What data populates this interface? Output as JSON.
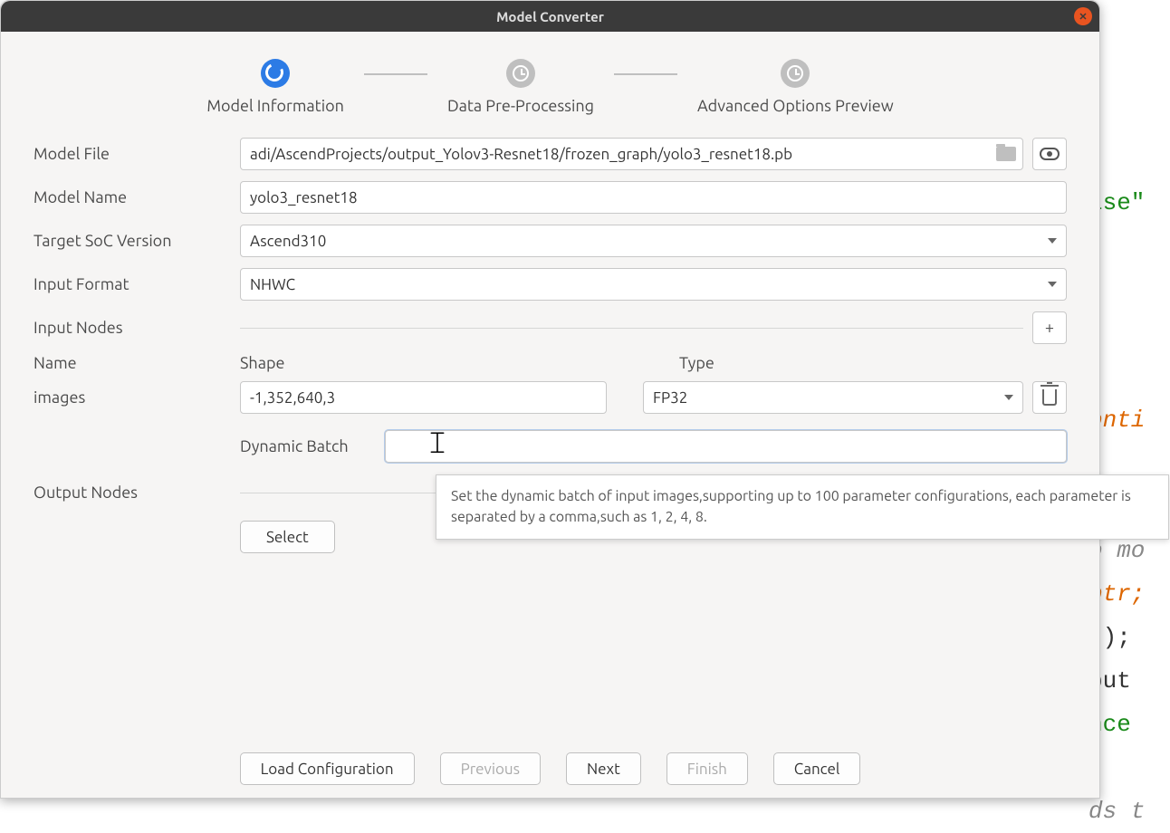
{
  "bgCode": {
    "l1": "lse\"",
    "l2": ";",
    "l3": "onti",
    "l4": "o mo",
    "l5": "ptr;",
    "l6": "t);",
    "l7": "put",
    "l8": "nce",
    "l9": "ds t"
  },
  "title": "Model Converter",
  "stepper": {
    "s1": "Model Information",
    "s2": "Data Pre-Processing",
    "s3": "Advanced Options  Preview"
  },
  "labels": {
    "modelFile": "Model File",
    "modelName": "Model Name",
    "targetSoc": "Target SoC Version",
    "inputFormat": "Input Format",
    "inputNodes": "Input Nodes",
    "name": "Name",
    "shape": "Shape",
    "type": "Type",
    "images": "images",
    "dynamicBatch": "Dynamic Batch",
    "outputNodes": "Output Nodes"
  },
  "values": {
    "modelFile": "adi/AscendProjects/output_Yolov3-Resnet18/frozen_graph/yolo3_resnet18.pb",
    "modelName": "yolo3_resnet18",
    "targetSoc": "Ascend310",
    "inputFormat": "NHWC",
    "shape": "-1,352,640,3",
    "type": "FP32",
    "dynamicBatch": ""
  },
  "tooltip": "Set the dynamic batch of input images,supporting up to 100 parameter configurations, each parameter is separated by a comma,such as 1, 2, 4, 8.",
  "buttons": {
    "select": "Select",
    "loadConfig": "Load Configuration",
    "previous": "Previous",
    "next": "Next",
    "finish": "Finish",
    "cancel": "Cancel"
  }
}
